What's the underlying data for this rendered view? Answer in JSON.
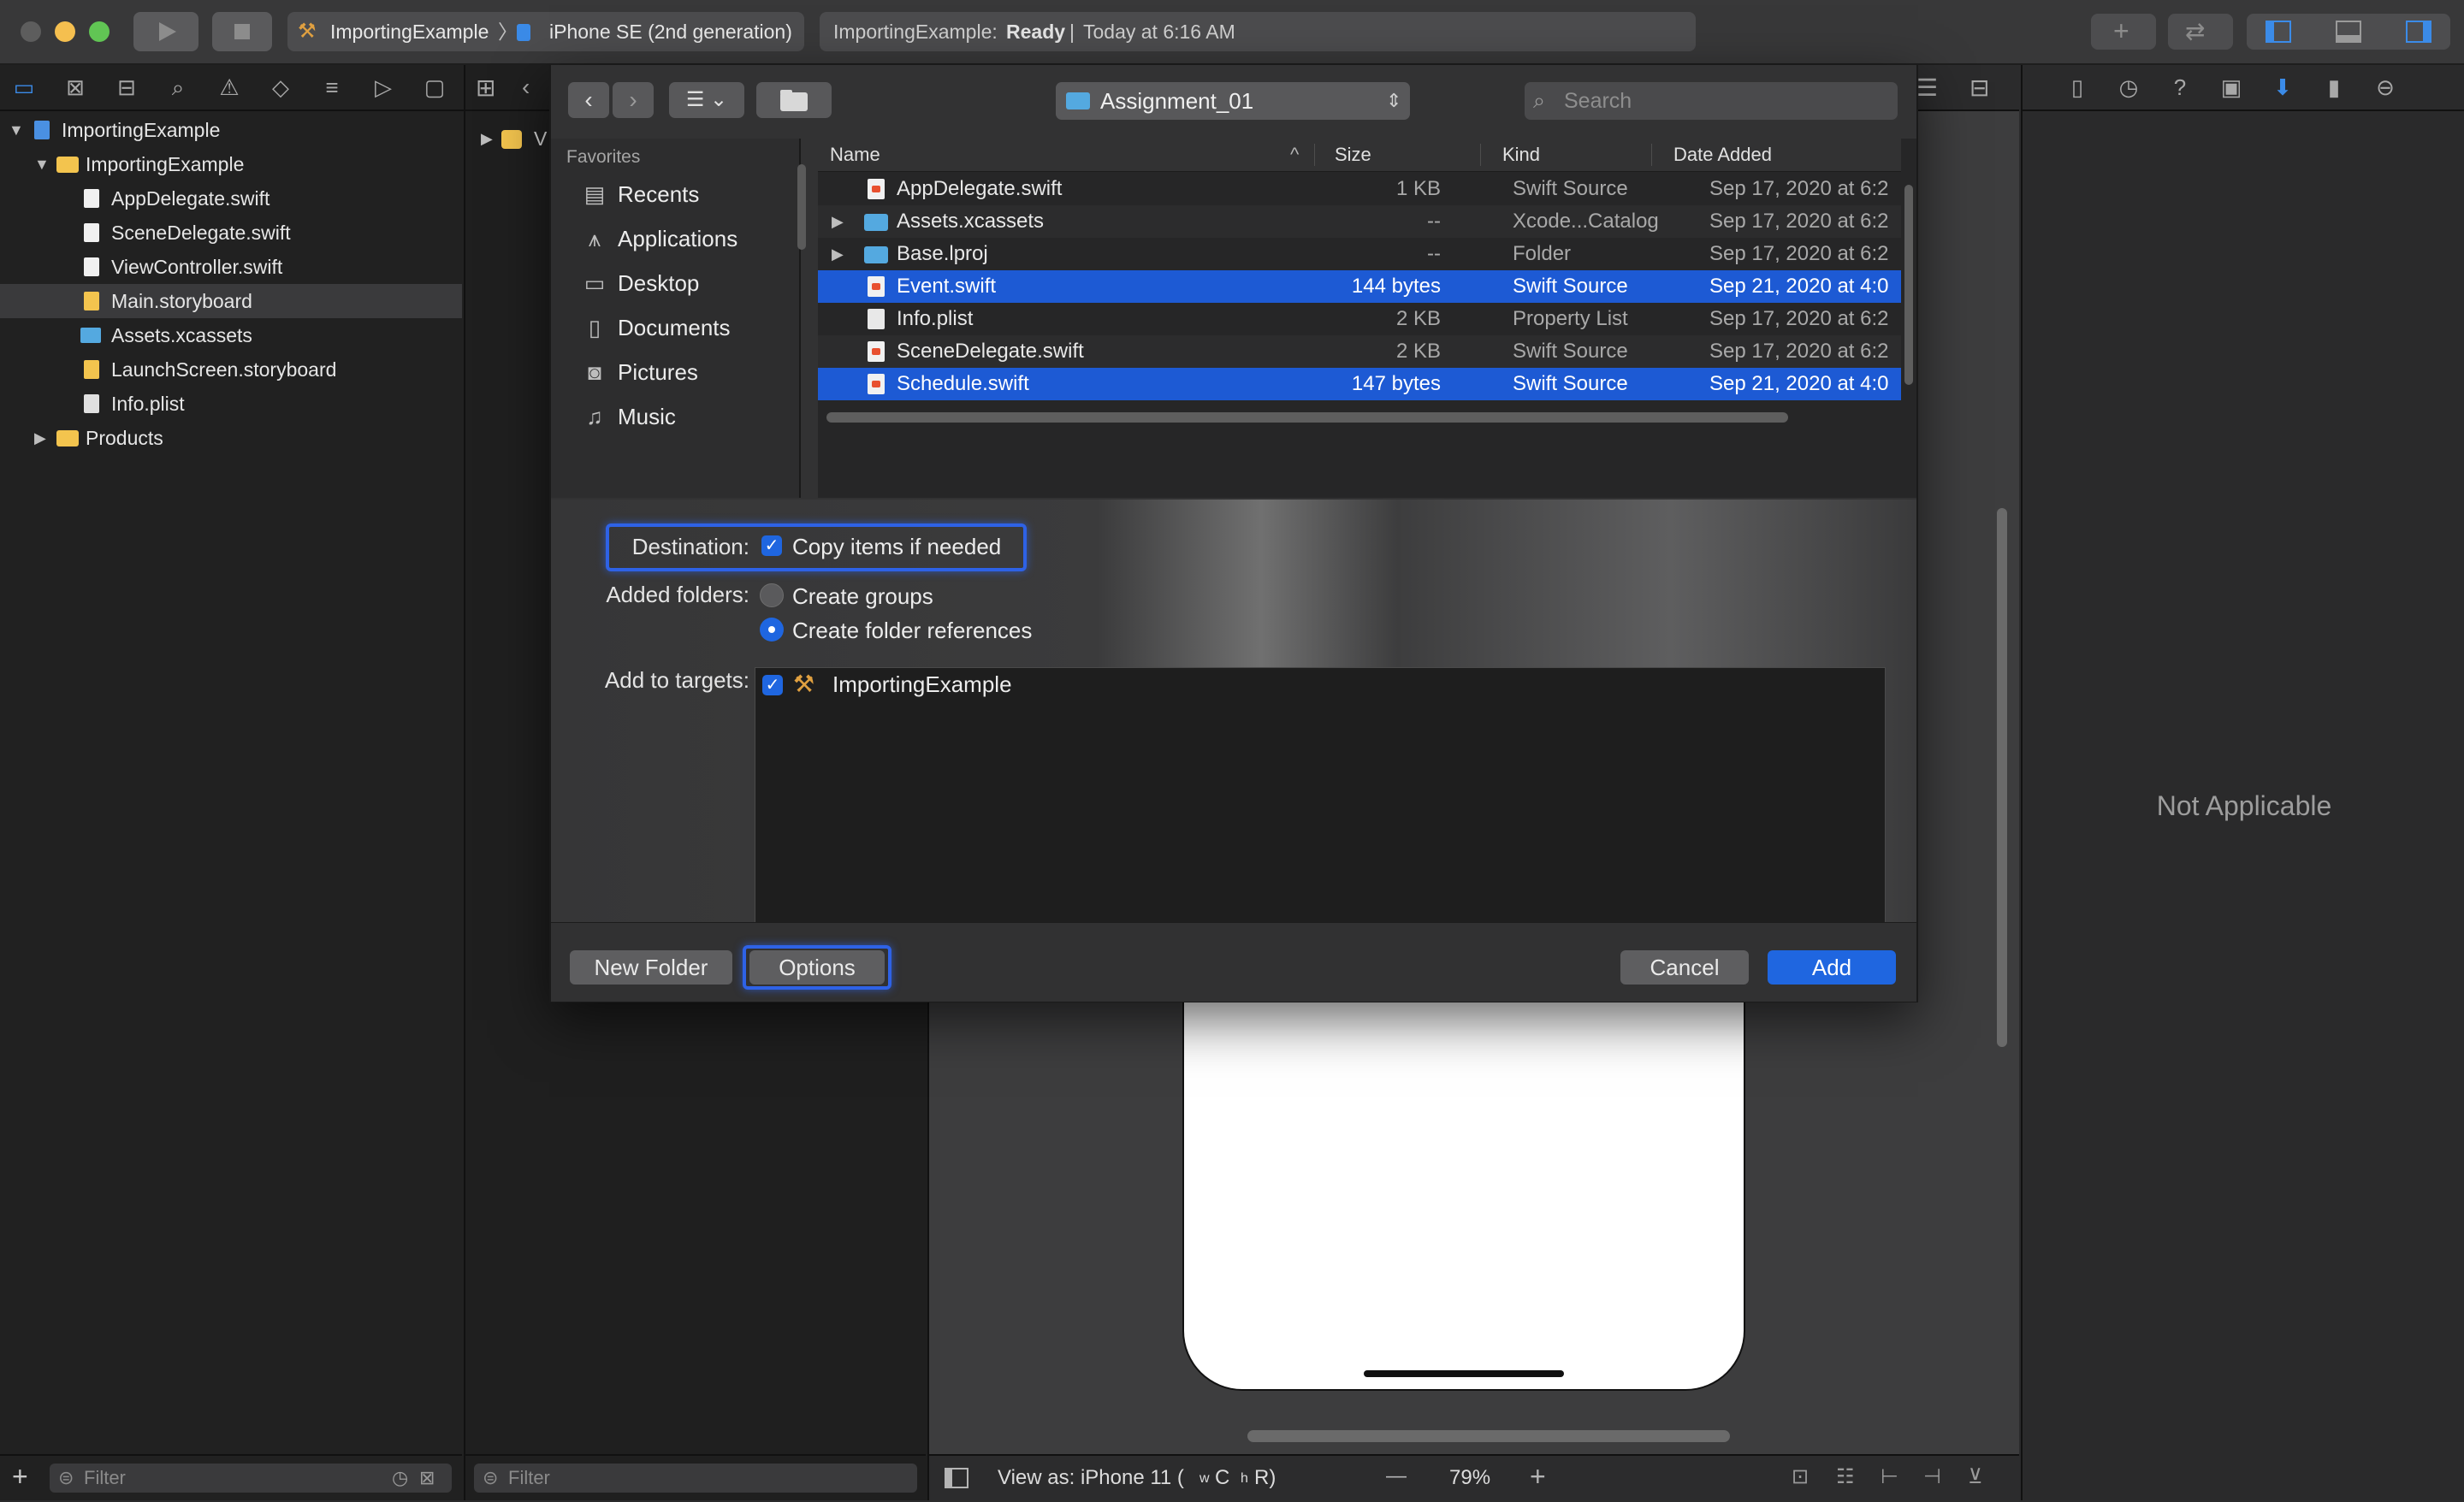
{
  "toolbar": {
    "scheme_target": "ImportingExample",
    "scheme_device": "iPhone SE (2nd generation)",
    "activity_project": "ImportingExample:",
    "activity_status": "Ready",
    "activity_time": "Today at 6:16 AM"
  },
  "navigator": {
    "items": [
      {
        "label": "ImportingExample"
      },
      {
        "label": "ImportingExample"
      },
      {
        "label": "AppDelegate.swift"
      },
      {
        "label": "SceneDelegate.swift"
      },
      {
        "label": "ViewController.swift"
      },
      {
        "label": "Main.storyboard"
      },
      {
        "label": "Assets.xcassets"
      },
      {
        "label": "LaunchScreen.storyboard"
      },
      {
        "label": "Info.plist"
      },
      {
        "label": "Products"
      }
    ],
    "filter_placeholder": "Filter"
  },
  "outline": {
    "first_item": "V",
    "filter_placeholder": "Filter"
  },
  "dialog": {
    "location": "Assignment_01",
    "search_placeholder": "Search",
    "sidebar_title": "Favorites",
    "sidebar_items": [
      {
        "label": "Recents"
      },
      {
        "label": "Applications"
      },
      {
        "label": "Desktop"
      },
      {
        "label": "Documents"
      },
      {
        "label": "Pictures"
      },
      {
        "label": "Music"
      }
    ],
    "columns": {
      "name": "Name",
      "size": "Size",
      "kind": "Kind",
      "date": "Date Added"
    },
    "files": [
      {
        "name": "AppDelegate.swift",
        "size": "1 KB",
        "kind": "Swift Source",
        "date": "Sep 17, 2020 at 6:2"
      },
      {
        "name": "Assets.xcassets",
        "size": "--",
        "kind": "Xcode...Catalog",
        "date": "Sep 17, 2020 at 6:2"
      },
      {
        "name": "Base.lproj",
        "size": "--",
        "kind": "Folder",
        "date": "Sep 17, 2020 at 6:2"
      },
      {
        "name": "Event.swift",
        "size": "144 bytes",
        "kind": "Swift Source",
        "date": "Sep 21, 2020 at 4:0"
      },
      {
        "name": "Info.plist",
        "size": "2 KB",
        "kind": "Property List",
        "date": "Sep 17, 2020 at 6:2"
      },
      {
        "name": "SceneDelegate.swift",
        "size": "2 KB",
        "kind": "Swift Source",
        "date": "Sep 17, 2020 at 6:2"
      },
      {
        "name": "Schedule.swift",
        "size": "147 bytes",
        "kind": "Swift Source",
        "date": "Sep 21, 2020 at 4:0"
      }
    ],
    "options": {
      "destination_label": "Destination:",
      "copy_items": "Copy items if needed",
      "copy_checked": true,
      "added_folders_label": "Added folders:",
      "create_groups": "Create groups",
      "create_folder_refs": "Create folder references",
      "selected_option": "Create folder references",
      "targets_label": "Add to targets:",
      "target_name": "ImportingExample",
      "target_checked": true
    },
    "footer": {
      "new_folder": "New Folder",
      "options": "Options",
      "cancel": "Cancel",
      "add": "Add"
    }
  },
  "inspector": {
    "message": "Not Applicable"
  },
  "canvas_bar": {
    "view_as": "View as: iPhone 11 (",
    "size_class_w": "w",
    "size_class_c": "C",
    "size_class_h": "h",
    "size_class_r": "R)",
    "zoom_minus": "—",
    "zoom": "79%",
    "zoom_plus": "+"
  },
  "colors": {
    "selection": "#1d5ad4",
    "accent": "#1f66e0",
    "close": "#5d5d5d",
    "minimize": "#f5bf4f",
    "zoom_light": "#61c554"
  }
}
